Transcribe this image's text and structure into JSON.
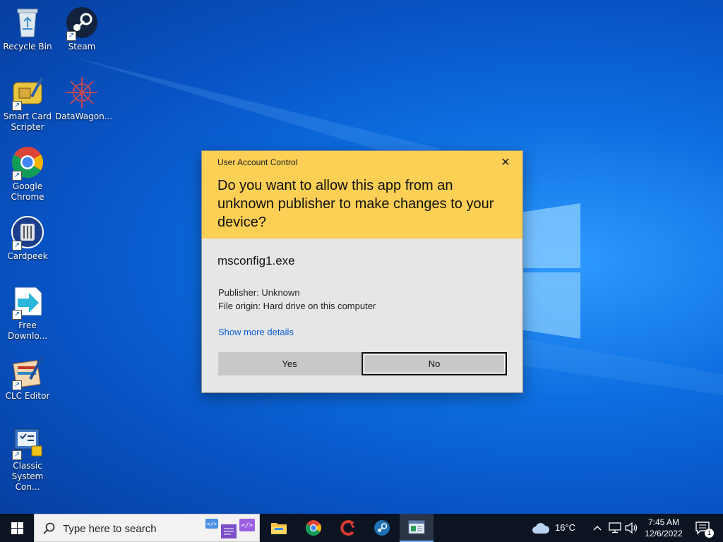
{
  "desktop": {
    "icons": [
      {
        "label": "Recycle Bin",
        "icon": "recycle-bin-icon"
      },
      {
        "label": "Steam",
        "icon": "steam-icon"
      },
      {
        "label": "Smart Card Scripter",
        "icon": "smart-card-scripter-icon"
      },
      {
        "label": "DataWagon...",
        "icon": "datawagon-icon"
      },
      {
        "label": "Google Chrome",
        "icon": "chrome-icon"
      },
      {
        "label": "Cardpeek",
        "icon": "cardpeek-icon"
      },
      {
        "label": "Free Downlo...",
        "icon": "free-download-icon"
      },
      {
        "label": "CLC Editor",
        "icon": "clc-editor-icon"
      },
      {
        "label": "Classic System Con...",
        "icon": "classic-system-control-icon"
      }
    ]
  },
  "dialog": {
    "title": "User Account Control",
    "close": "✕",
    "question": "Do you want to allow this app from an unknown publisher to make changes to your device?",
    "app_name": "msconfig1.exe",
    "publisher": "Publisher: Unknown",
    "origin": "File origin: Hard drive on this computer",
    "more_details": "Show more details",
    "yes_label": "Yes",
    "no_label": "No"
  },
  "taskbar": {
    "search_placeholder": "Type here to search",
    "pinned": [
      "file-explorer-icon",
      "chrome-icon",
      "ccleaner-icon",
      "steam-icon",
      "system-configuration-icon"
    ],
    "weather": "16°C",
    "time": "7:45 AM",
    "date": "12/6/2022",
    "notification_count": "1"
  },
  "colors": {
    "dialog_header": "#fccf55",
    "dialog_body": "#e6e6e6",
    "link": "#0a5ed7",
    "taskbar": "#0b1420"
  }
}
